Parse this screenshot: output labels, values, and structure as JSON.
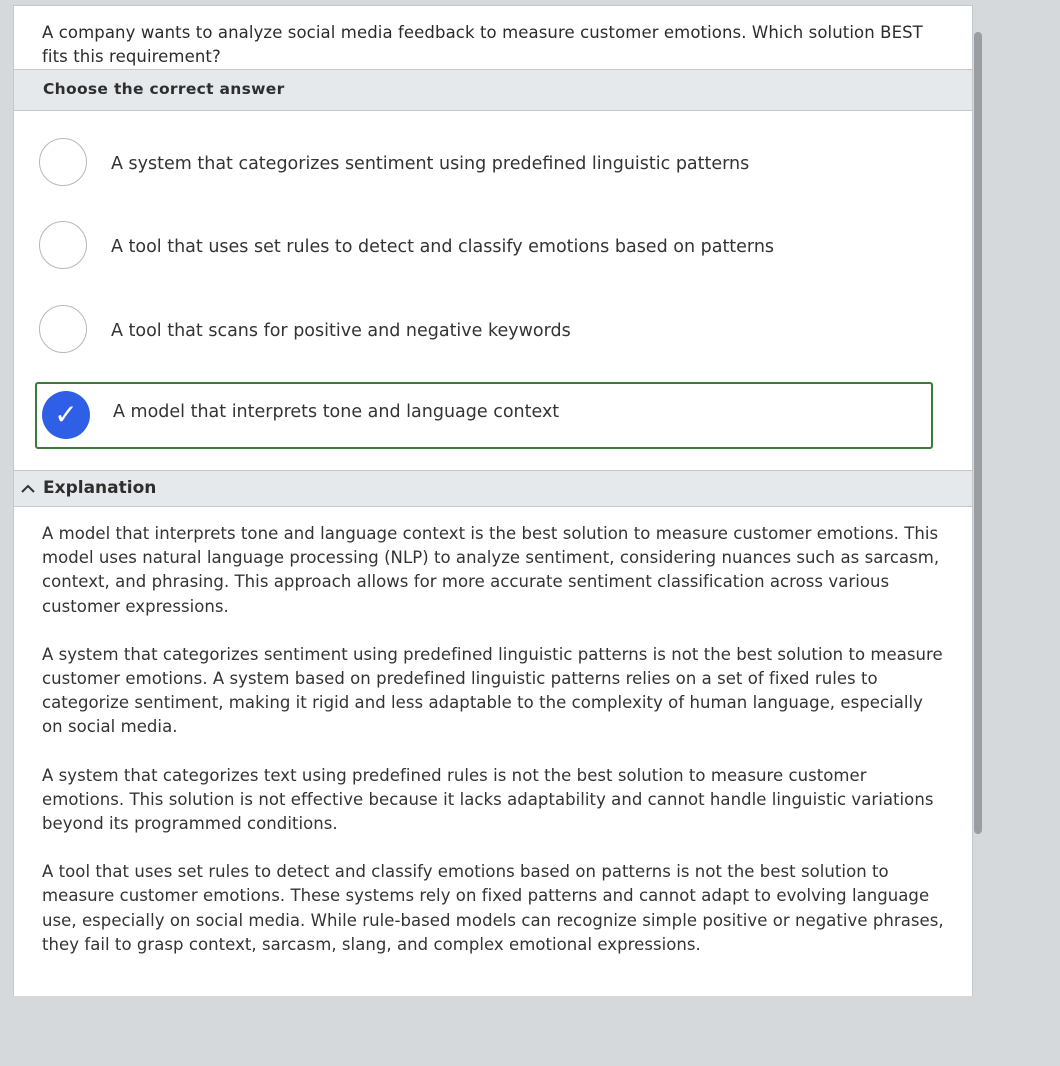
{
  "question": "A company wants to analyze social media feedback to measure customer emotions. Which solution BEST fits this requirement?",
  "choose_label": "Choose the correct answer",
  "options": [
    {
      "label": "A system that categorizes sentiment using predefined linguistic patterns",
      "selected": false
    },
    {
      "label": "A tool that uses set rules to detect and classify emotions based on patterns",
      "selected": false
    },
    {
      "label": "A tool that scans for positive and negative keywords",
      "selected": false
    },
    {
      "label": "A model that interprets tone and language context",
      "selected": true
    }
  ],
  "checkmark": "✓",
  "explanation": {
    "title": "Explanation",
    "icon": "chevron-up-icon",
    "paragraphs": [
      "A model that interprets tone and language context is the best solution to measure customer emotions. This model uses natural language processing (NLP) to analyze sentiment, considering nuances such as sarcasm, context, and phrasing. This approach allows for more accurate sentiment classification across various customer expressions.",
      "A system that categorizes sentiment using predefined linguistic patterns is not the best solution to measure customer emotions. A system based on predefined linguistic patterns relies on a set of fixed rules to categorize sentiment, making it rigid and less adaptable to the complexity of human language, especially on social media.",
      "A system that categorizes text using predefined rules is not the best solution to measure customer emotions. This solution is not effective because it lacks adaptability and cannot handle linguistic variations beyond its programmed conditions.",
      "A tool that uses set rules to detect and classify emotions based on patterns is not the best solution to measure customer emotions. These systems rely on fixed patterns and cannot adapt to evolving language use, especially on social media. While rule-based models can recognize simple positive or negative phrases, they fail to grasp context, sarcasm, slang, and complex emotional expressions."
    ]
  },
  "colors": {
    "selected_radio": "#2f5fe6",
    "selected_border": "#3c7a3a",
    "header_bg": "#e6e9ec",
    "page_bg": "#d6d9dc"
  }
}
